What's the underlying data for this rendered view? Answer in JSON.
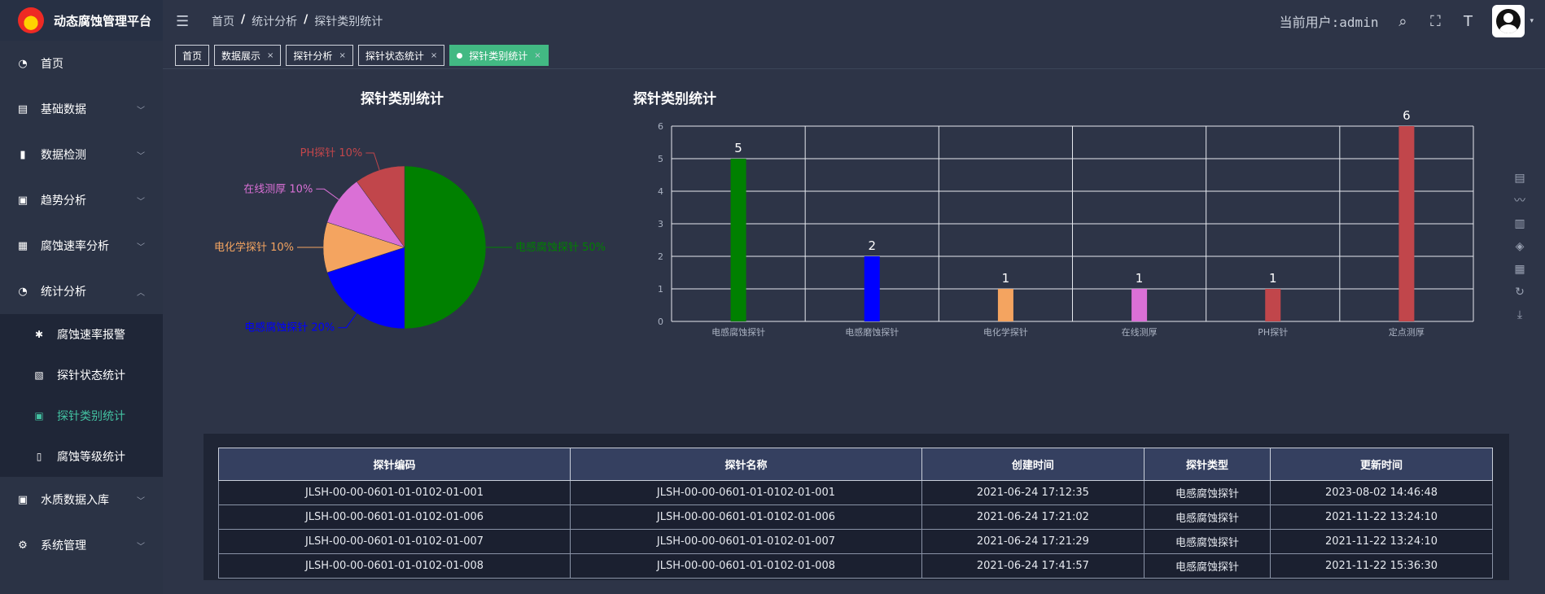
{
  "app": {
    "title": "动态腐蚀管理平台"
  },
  "sidebar": {
    "items": [
      {
        "label": "首页",
        "icon": "dashboard-icon"
      },
      {
        "label": "基础数据",
        "icon": "document-icon"
      },
      {
        "label": "数据检测",
        "icon": "bar-chart-icon"
      },
      {
        "label": "趋势分析",
        "icon": "trend-icon"
      },
      {
        "label": "腐蚀速率分析",
        "icon": "grid-icon"
      },
      {
        "label": "统计分析",
        "icon": "dashboard-icon"
      },
      {
        "label": "水质数据入库",
        "icon": "trend-icon"
      },
      {
        "label": "系统管理",
        "icon": "gear-icon"
      }
    ],
    "sub_items": [
      {
        "label": "腐蚀速率报警",
        "icon": "bug-icon"
      },
      {
        "label": "探针状态统计",
        "icon": "file-icon"
      },
      {
        "label": "探针类别统计",
        "icon": "trend-icon"
      },
      {
        "label": "腐蚀等级统计",
        "icon": "book-icon"
      }
    ]
  },
  "header": {
    "breadcrumb": [
      "首页",
      "统计分析",
      "探针类别统计"
    ],
    "current_user": "当前用户:admin"
  },
  "tabs": [
    {
      "label": "首页"
    },
    {
      "label": "数据展示"
    },
    {
      "label": "探针分析"
    },
    {
      "label": "探针状态统计"
    },
    {
      "label": "探针类别统计"
    }
  ],
  "colors": {
    "accent": "#42b983",
    "green": "#008000",
    "blue": "#0000ff",
    "orange": "#f4a460",
    "violet": "#da70d6",
    "red": "#c1464b"
  },
  "chart_data": [
    {
      "type": "pie",
      "title": "探针类别统计",
      "slices": [
        {
          "label": "电感腐蚀探针 50%",
          "value": 50,
          "color": "#008000"
        },
        {
          "label": "电感腐蚀探针 20%",
          "value": 20,
          "color": "#0000ff"
        },
        {
          "label": "电化学探针 10%",
          "value": 10,
          "color": "#f4a460"
        },
        {
          "label": "在线测厚 10%",
          "value": 10,
          "color": "#da70d6"
        },
        {
          "label": "PH探针 10%",
          "value": 10,
          "color": "#c1464b"
        }
      ]
    },
    {
      "type": "bar",
      "title": "探针类别统计",
      "categories": [
        "电感腐蚀探针",
        "电感磨蚀探针",
        "电化学探针",
        "在线测厚",
        "PH探针",
        "定点测厚"
      ],
      "values": [
        5,
        2,
        1,
        1,
        1,
        6
      ],
      "colors": [
        "#008000",
        "#0000ff",
        "#f4a460",
        "#da70d6",
        "#c1464b",
        "#c1464b"
      ],
      "ylim": [
        0,
        6
      ],
      "yticks": [
        0,
        1,
        2,
        3,
        4,
        5,
        6
      ],
      "grid": true
    }
  ],
  "table": {
    "columns": [
      "探针编码",
      "探针名称",
      "创建时间",
      "探针类型",
      "更新时间"
    ],
    "rows": [
      [
        "JLSH-00-00-0601-01-0102-01-001",
        "JLSH-00-00-0601-01-0102-01-001",
        "2021-06-24 17:12:35",
        "电感腐蚀探针",
        "2023-08-02 14:46:48"
      ],
      [
        "JLSH-00-00-0601-01-0102-01-006",
        "JLSH-00-00-0601-01-0102-01-006",
        "2021-06-24 17:21:02",
        "电感腐蚀探针",
        "2021-11-22 13:24:10"
      ],
      [
        "JLSH-00-00-0601-01-0102-01-007",
        "JLSH-00-00-0601-01-0102-01-007",
        "2021-06-24 17:21:29",
        "电感腐蚀探针",
        "2021-11-22 13:24:10"
      ],
      [
        "JLSH-00-00-0601-01-0102-01-008",
        "JLSH-00-00-0601-01-0102-01-008",
        "2021-06-24 17:41:57",
        "电感腐蚀探针",
        "2021-11-22 15:36:30"
      ]
    ]
  }
}
